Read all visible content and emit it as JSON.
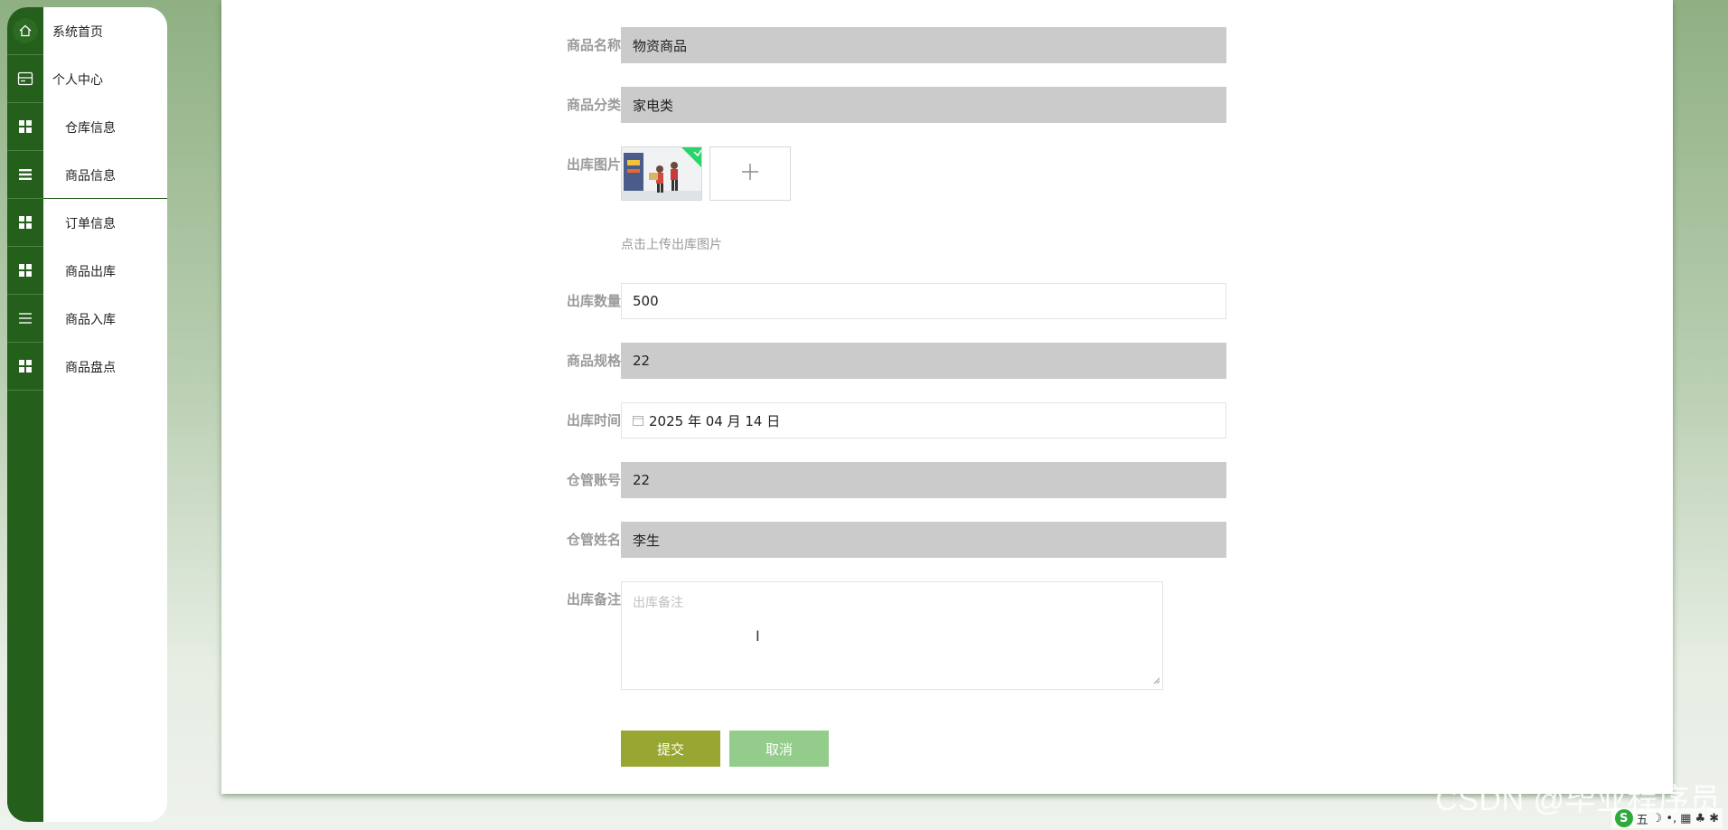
{
  "sidebar": {
    "items": [
      {
        "label": "系统首页",
        "icon": "home-icon"
      },
      {
        "label": "个人中心",
        "icon": "card-icon"
      },
      {
        "label": "仓库信息",
        "icon": "grid-icon"
      },
      {
        "label": "商品信息",
        "icon": "list-icon"
      },
      {
        "label": "订单信息",
        "icon": "grid-icon"
      },
      {
        "label": "商品出库",
        "icon": "grid-icon"
      },
      {
        "label": "商品入库",
        "icon": "list-icon"
      },
      {
        "label": "商品盘点",
        "icon": "grid-icon"
      }
    ]
  },
  "form": {
    "product_name": {
      "label": "商品名称",
      "value": "物资商品"
    },
    "product_category": {
      "label": "商品分类",
      "value": "家电类"
    },
    "image": {
      "label": "出库图片",
      "hint": "点击上传出库图片"
    },
    "quantity": {
      "label": "出库数量",
      "value": "500"
    },
    "spec": {
      "label": "商品规格",
      "value": "22"
    },
    "time": {
      "label": "出库时间",
      "value": "2025 年 04 月 14 日"
    },
    "account": {
      "label": "仓管账号",
      "value": "22"
    },
    "keeper_name": {
      "label": "仓管姓名",
      "value": "李生"
    },
    "remark": {
      "label": "出库备注",
      "placeholder": "出库备注"
    }
  },
  "buttons": {
    "submit": "提交",
    "cancel": "取消"
  },
  "watermark": "CSDN @毕业程序员",
  "tray": {
    "items": [
      "五",
      "☽",
      "•,",
      "▦",
      "♣",
      "✱"
    ]
  },
  "colors": {
    "sidebar_rail": "#245f1b",
    "submit_button": "#98a632",
    "cancel_button": "#94cc8b",
    "disabled_field": "#cbcbcb"
  }
}
